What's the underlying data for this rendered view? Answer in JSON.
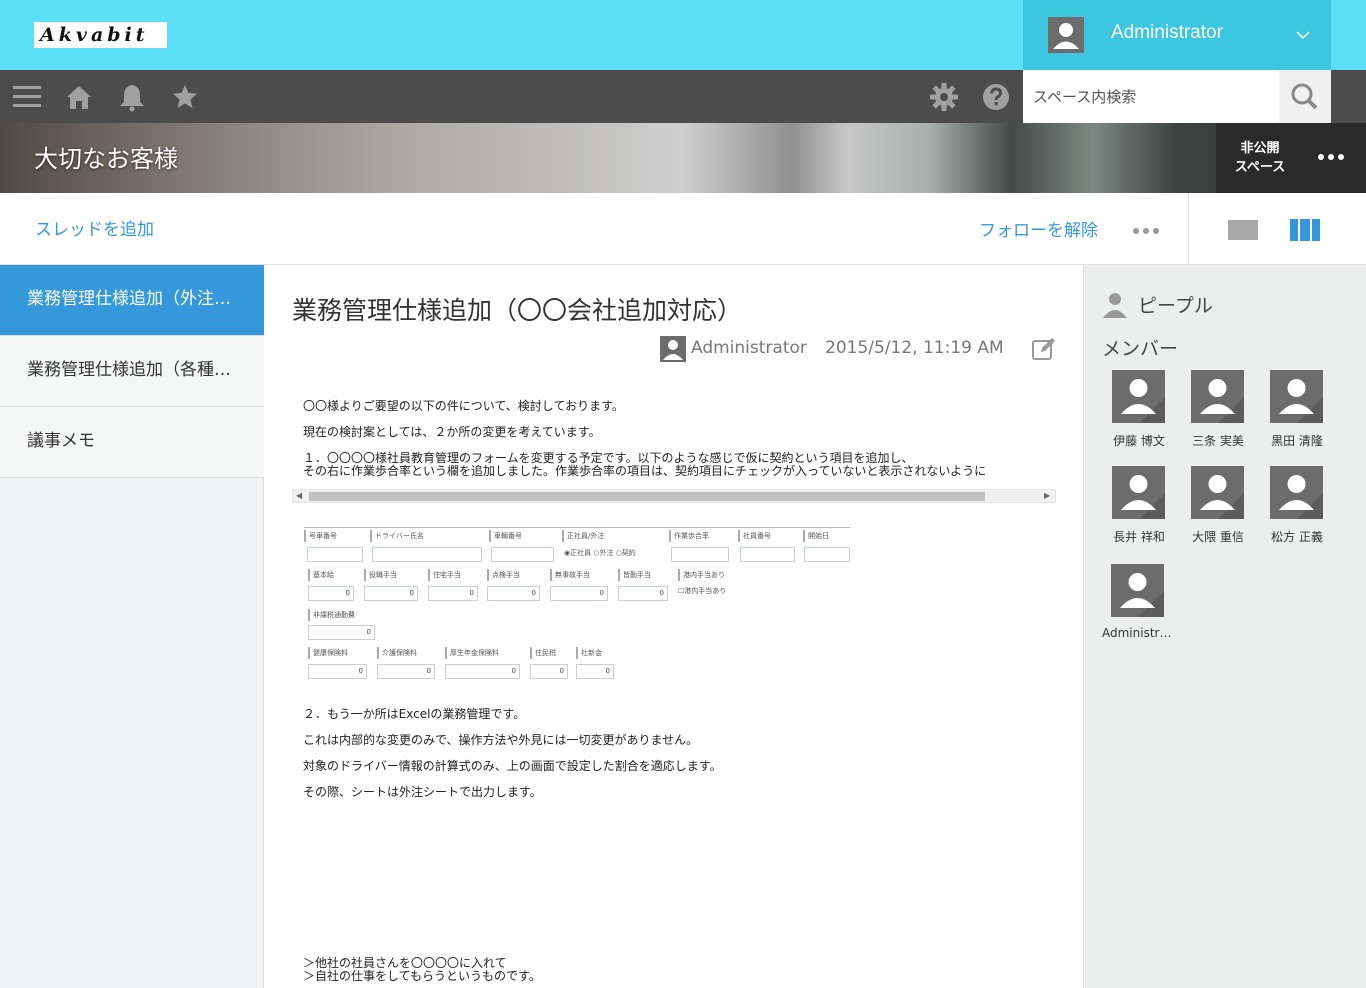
{
  "header": {
    "logo_text": "Akvabit",
    "user_name": "Administrator",
    "search_placeholder": "スペース内検索"
  },
  "space": {
    "title": "大切なお客様",
    "private_line1": "非公開",
    "private_line2": "スペース"
  },
  "toolbar": {
    "add_thread": "スレッドを追加",
    "unfollow": "フォローを解除"
  },
  "threads": [
    {
      "label": "業務管理仕様追加（外注…"
    },
    {
      "label": "業務管理仕様追加（各種…"
    },
    {
      "label": "議事メモ"
    }
  ],
  "post": {
    "title": "業務管理仕様追加（〇〇会社追加対応）",
    "author": "Administrator",
    "date": "2015/5/12, 11:19 AM",
    "lines": [
      "〇〇様よりご要望の以下の件について、検討しております。",
      "現在の検討案としては、２か所の変更を考えています。",
      "１．〇〇〇〇様社員教育管理のフォームを変更する予定です。以下のような感じで仮に契約という項目を追加し、",
      "その右に作業歩合率という欄を追加しました。作業歩合率の項目は、契約項目にチェックが入っていないと表示されないように",
      "２．もう一か所はExcelの業務管理です。",
      "これは内部的な変更のみで、操作方法や外見には一切変更がありません。",
      "対象のドライバー情報の計算式のみ、上の画面で設定した割合を適応します。",
      "その際、シートは外注シートで出力します。",
      "＞他社の社員さんを〇〇〇〇に入れて",
      "＞自社の仕事をしてもらうというものです。"
    ],
    "form_labels": {
      "row1": [
        "号車番号",
        "ドライバー氏名",
        "車輌番号",
        "正社員/外注",
        "作業歩合率",
        "社員番号",
        "開始日"
      ],
      "radio": [
        "正社員",
        "外注",
        "契約"
      ],
      "row2": [
        "基本給",
        "役職手当",
        "住宅手当",
        "点検手当",
        "無事故手当",
        "皆勤手当",
        "港内手当あり"
      ],
      "row2_check": "港内手当あり",
      "row3": [
        "非課税通勤費"
      ],
      "row4": [
        "健康保険料",
        "介護保険料",
        "厚生年金保険料",
        "住民税",
        "社新会"
      ],
      "zero": "0"
    }
  },
  "people": {
    "heading": "ピープル",
    "members_heading": "メンバー",
    "members": [
      {
        "name": "伊藤 博文"
      },
      {
        "name": "三条 実美"
      },
      {
        "name": "黒田 清隆"
      },
      {
        "name": "長井 祥和"
      },
      {
        "name": "大隈 重信"
      },
      {
        "name": "松方 正義"
      },
      {
        "name": "Administrator"
      }
    ]
  },
  "colors": {
    "header_bg": "#5be0f8",
    "user_menu_bg": "#3cc6df",
    "navbar_bg": "#4c4c4c",
    "accent": "#3498db"
  },
  "icons": [
    "menu-icon",
    "home-icon",
    "bell-icon",
    "star-icon",
    "gear-icon",
    "help-icon",
    "search-icon",
    "edit-icon",
    "more-icon",
    "person-icon"
  ]
}
